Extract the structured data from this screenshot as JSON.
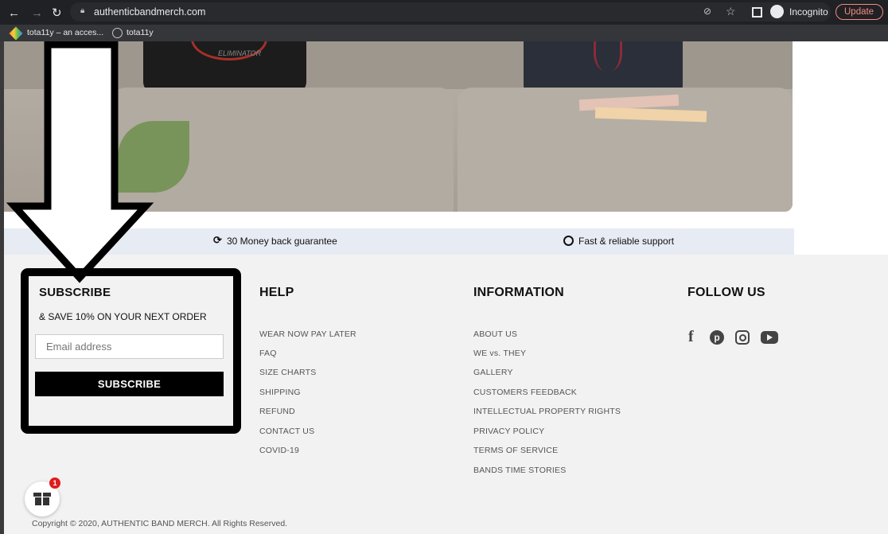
{
  "browser": {
    "url": "authenticbandmerch.com",
    "profile": "Incognito",
    "update_label": "Update",
    "bookmarks": [
      {
        "label": "tota11y – an acces..."
      },
      {
        "label": "tota11y"
      }
    ]
  },
  "hero": {
    "cushion_text": "ELIMINATOR"
  },
  "features": {
    "left": "30 Money back guarantee",
    "right": "Fast & reliable support"
  },
  "footer": {
    "subscribe": {
      "title": "SUBSCRIBE",
      "subtitle": "& SAVE 10% ON YOUR NEXT ORDER",
      "email_placeholder": "Email address",
      "button_label": "SUBSCRIBE"
    },
    "help": {
      "title": "HELP",
      "links": [
        "WEAR NOW PAY LATER",
        "FAQ",
        "SIZE CHARTS",
        "SHIPPING",
        "REFUND",
        "CONTACT US",
        "COVID-19"
      ]
    },
    "information": {
      "title": "INFORMATION",
      "links": [
        "ABOUT US",
        "WE vs. THEY",
        "GALLERY",
        "CUSTOMERS FEEDBACK",
        "INTELLECTUAL PROPERTY RIGHTS",
        "PRIVACY POLICY",
        "TERMS OF SERVICE",
        "BANDS TIME STORIES"
      ]
    },
    "follow": {
      "title": "FOLLOW US",
      "icons": [
        "facebook-icon",
        "pinterest-icon",
        "instagram-icon",
        "youtube-icon"
      ]
    },
    "copyright": "Copyright © 2020, AUTHENTIC BAND MERCH. All Rights Reserved."
  },
  "gift_widget": {
    "badge_count": "1"
  },
  "colors": {
    "accent_red": "#e01b1b",
    "button_black": "#000000"
  }
}
